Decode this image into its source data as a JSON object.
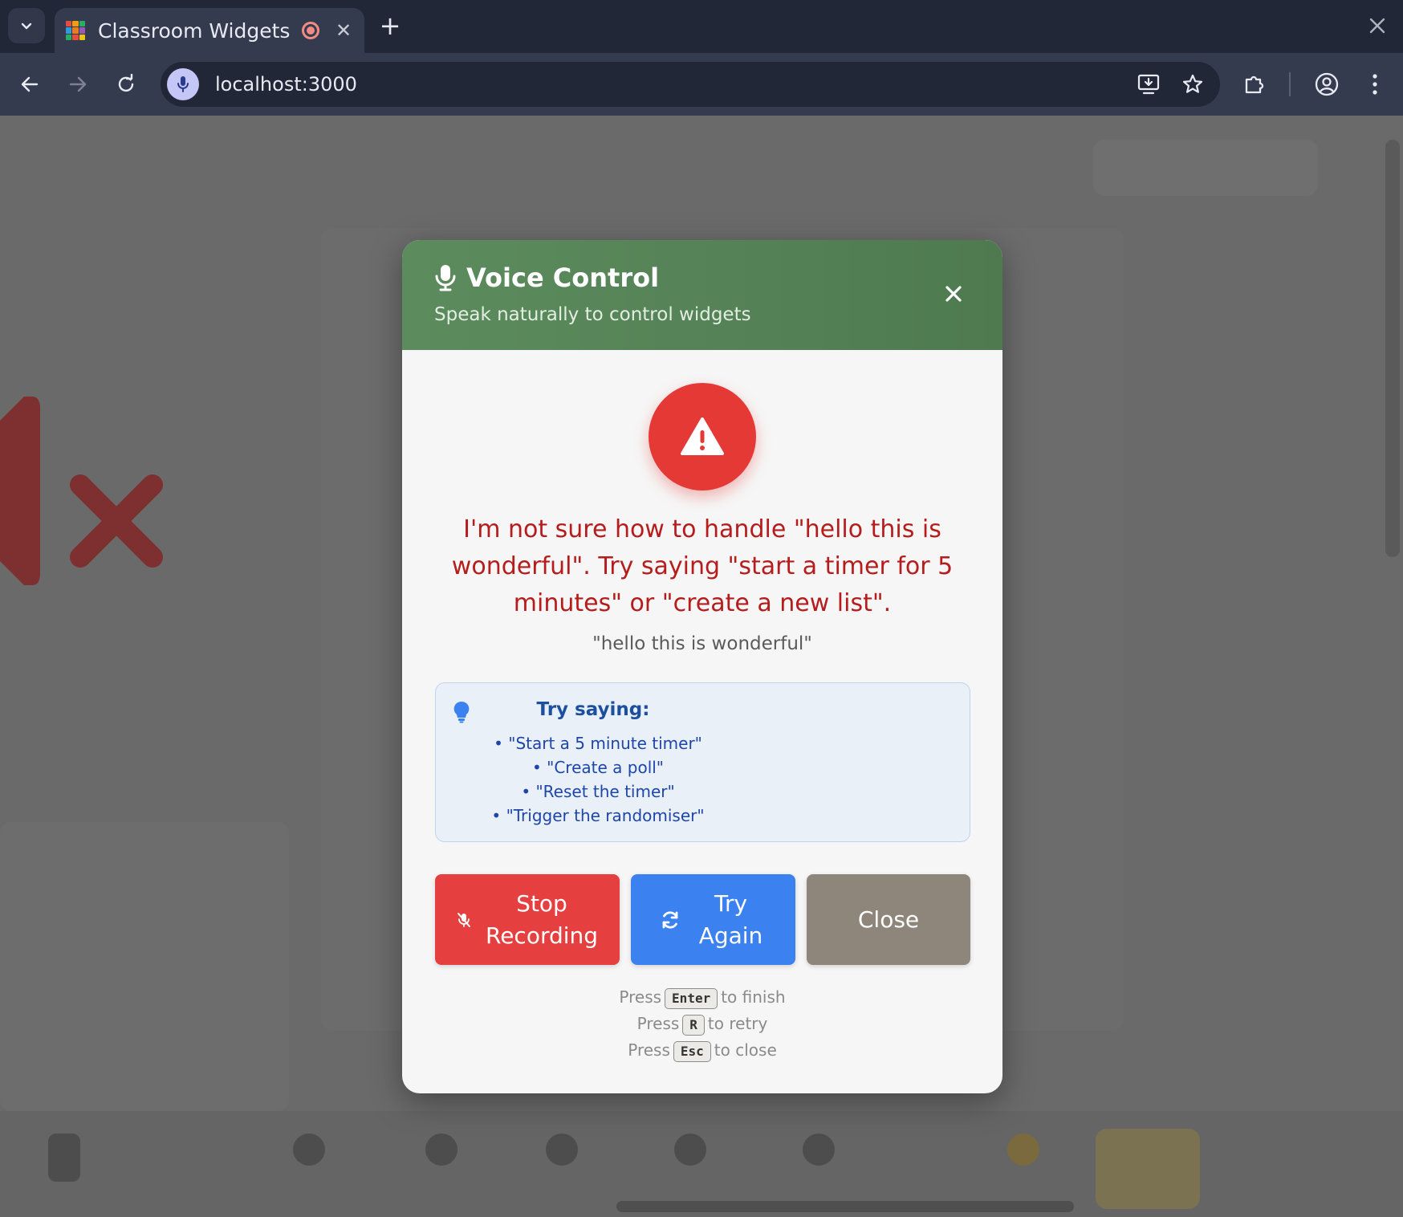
{
  "browser": {
    "tab_title": "Classroom Widgets",
    "tab_close_symbol": "✕",
    "new_tab_symbol": "+",
    "url": "localhost:3000"
  },
  "modal": {
    "title": "Voice Control",
    "subtitle": "Speak naturally to control widgets",
    "error_message": "I'm not sure how to handle \"hello this is wonderful\". Try saying \"start a timer for 5 minutes\" or \"create a new list\".",
    "transcript": "\"hello this is wonderful\"",
    "tips": {
      "title": "Try saying:",
      "items": [
        "\"Start a 5 minute timer\"",
        "\"Create a poll\"",
        "\"Reset the timer\"",
        "\"Trigger the randomiser\""
      ]
    },
    "buttons": {
      "stop": "Stop Recording",
      "retry": "Try Again",
      "close": "Close"
    },
    "shortcuts": [
      {
        "pre": "Press",
        "key": "Enter",
        "post": "to finish"
      },
      {
        "pre": "Press",
        "key": "R",
        "post": "to retry"
      },
      {
        "pre": "Press",
        "key": "Esc",
        "post": "to close"
      }
    ]
  },
  "colors": {
    "header_green": "#5c8c5e",
    "error_red": "#b71c1c",
    "alert_red": "#e53935",
    "stop_red": "#e53f3f",
    "retry_blue": "#3b82f0",
    "close_taupe": "#8f867b",
    "tips_blue": "#1e46a8"
  },
  "icons": {
    "header": "microphone-icon",
    "alert": "warning-triangle-icon",
    "tips": "lightbulb-icon",
    "stop": "mic-off-icon",
    "retry": "refresh-icon"
  }
}
